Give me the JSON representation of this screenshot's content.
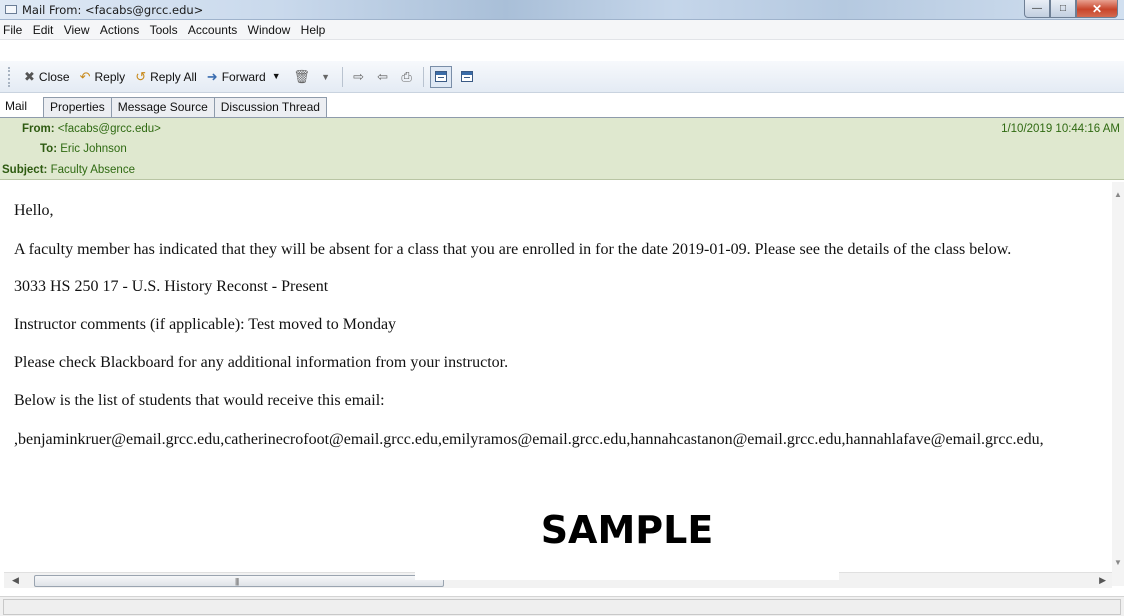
{
  "window": {
    "title": "Mail From: <facabs@grcc.edu>"
  },
  "menu": [
    "File",
    "Edit",
    "View",
    "Actions",
    "Tools",
    "Accounts",
    "Window",
    "Help"
  ],
  "toolbar": {
    "close_label": "Close",
    "reply_label": "Reply",
    "reply_all_label": "Reply All",
    "forward_label": "Forward"
  },
  "tabs": [
    "Mail",
    "Properties",
    "Message Source",
    "Discussion Thread"
  ],
  "header": {
    "from_label": "From:",
    "from_value": "<facabs@grcc.edu>",
    "to_label": "To:",
    "to_value": "Eric Johnson",
    "subject_label": "Subject:",
    "subject_value": "Faculty Absence",
    "date": "1/10/2019 10:44:16 AM"
  },
  "body": {
    "lines": [
      "Hello,",
      "A faculty member has indicated that they will be absent for a class that you are enrolled in for the date 2019-01-09. Please see the details of the class below.",
      "3033 HS 250 17 - U.S. History Reconst - Present",
      "Instructor comments (if applicable): Test moved to Monday",
      "Please check Blackboard for any additional information from your instructor.",
      "Below is the list of students that would receive this email:",
      ",benjaminkruer@email.grcc.edu,catherinecrofoot@email.grcc.edu,emilyramos@email.grcc.edu,hannahcastanon@email.grcc.edu,hannahlafave@email.grcc.edu,"
    ]
  },
  "watermark": "SAMPLE",
  "icons": {
    "mail": "envelope-icon",
    "close": "close-x-icon",
    "reply": "reply-icon",
    "reply_all": "reply-all-icon",
    "forward": "forward-icon",
    "delete": "trash-icon",
    "print": "printer-icon"
  }
}
